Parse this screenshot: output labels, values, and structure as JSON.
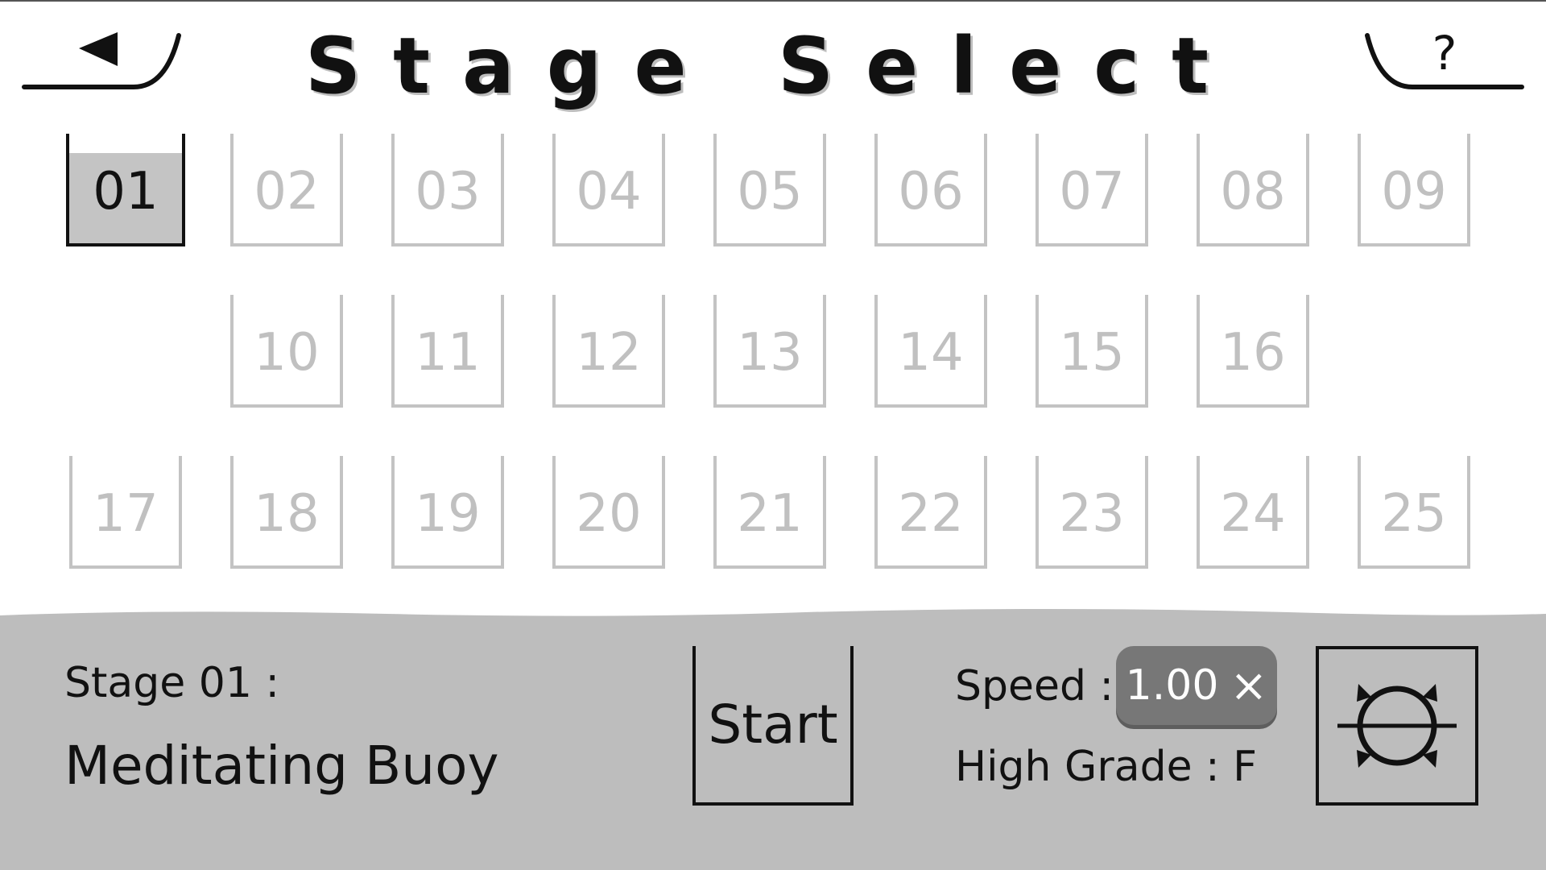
{
  "header": {
    "title": "Stage Select",
    "back_icon": "back-arrow-icon",
    "help_icon": "question-mark-icon",
    "help_glyph": "?"
  },
  "stages": {
    "selected": "01",
    "rows": [
      [
        "01",
        "02",
        "03",
        "04",
        "05",
        "06",
        "07",
        "08",
        "09"
      ],
      [
        "10",
        "11",
        "12",
        "13",
        "14",
        "15",
        "16"
      ],
      [
        "17",
        "18",
        "19",
        "20",
        "21",
        "22",
        "23",
        "24",
        "25"
      ]
    ]
  },
  "info": {
    "stage_label": "Stage 01 :",
    "stage_name": "Meditating Buoy",
    "start_label": "Start",
    "speed_label": "Speed :",
    "speed_value": "1.00",
    "speed_multiplier": "×",
    "high_grade_label": "High Grade : F",
    "settings_icon": "sun-horizon-icon"
  },
  "colors": {
    "panel": "#bdbdbd",
    "tile_border": "#c3c3c3",
    "selected_fill": "#c4c4c4",
    "speed_pill": "#777777"
  }
}
